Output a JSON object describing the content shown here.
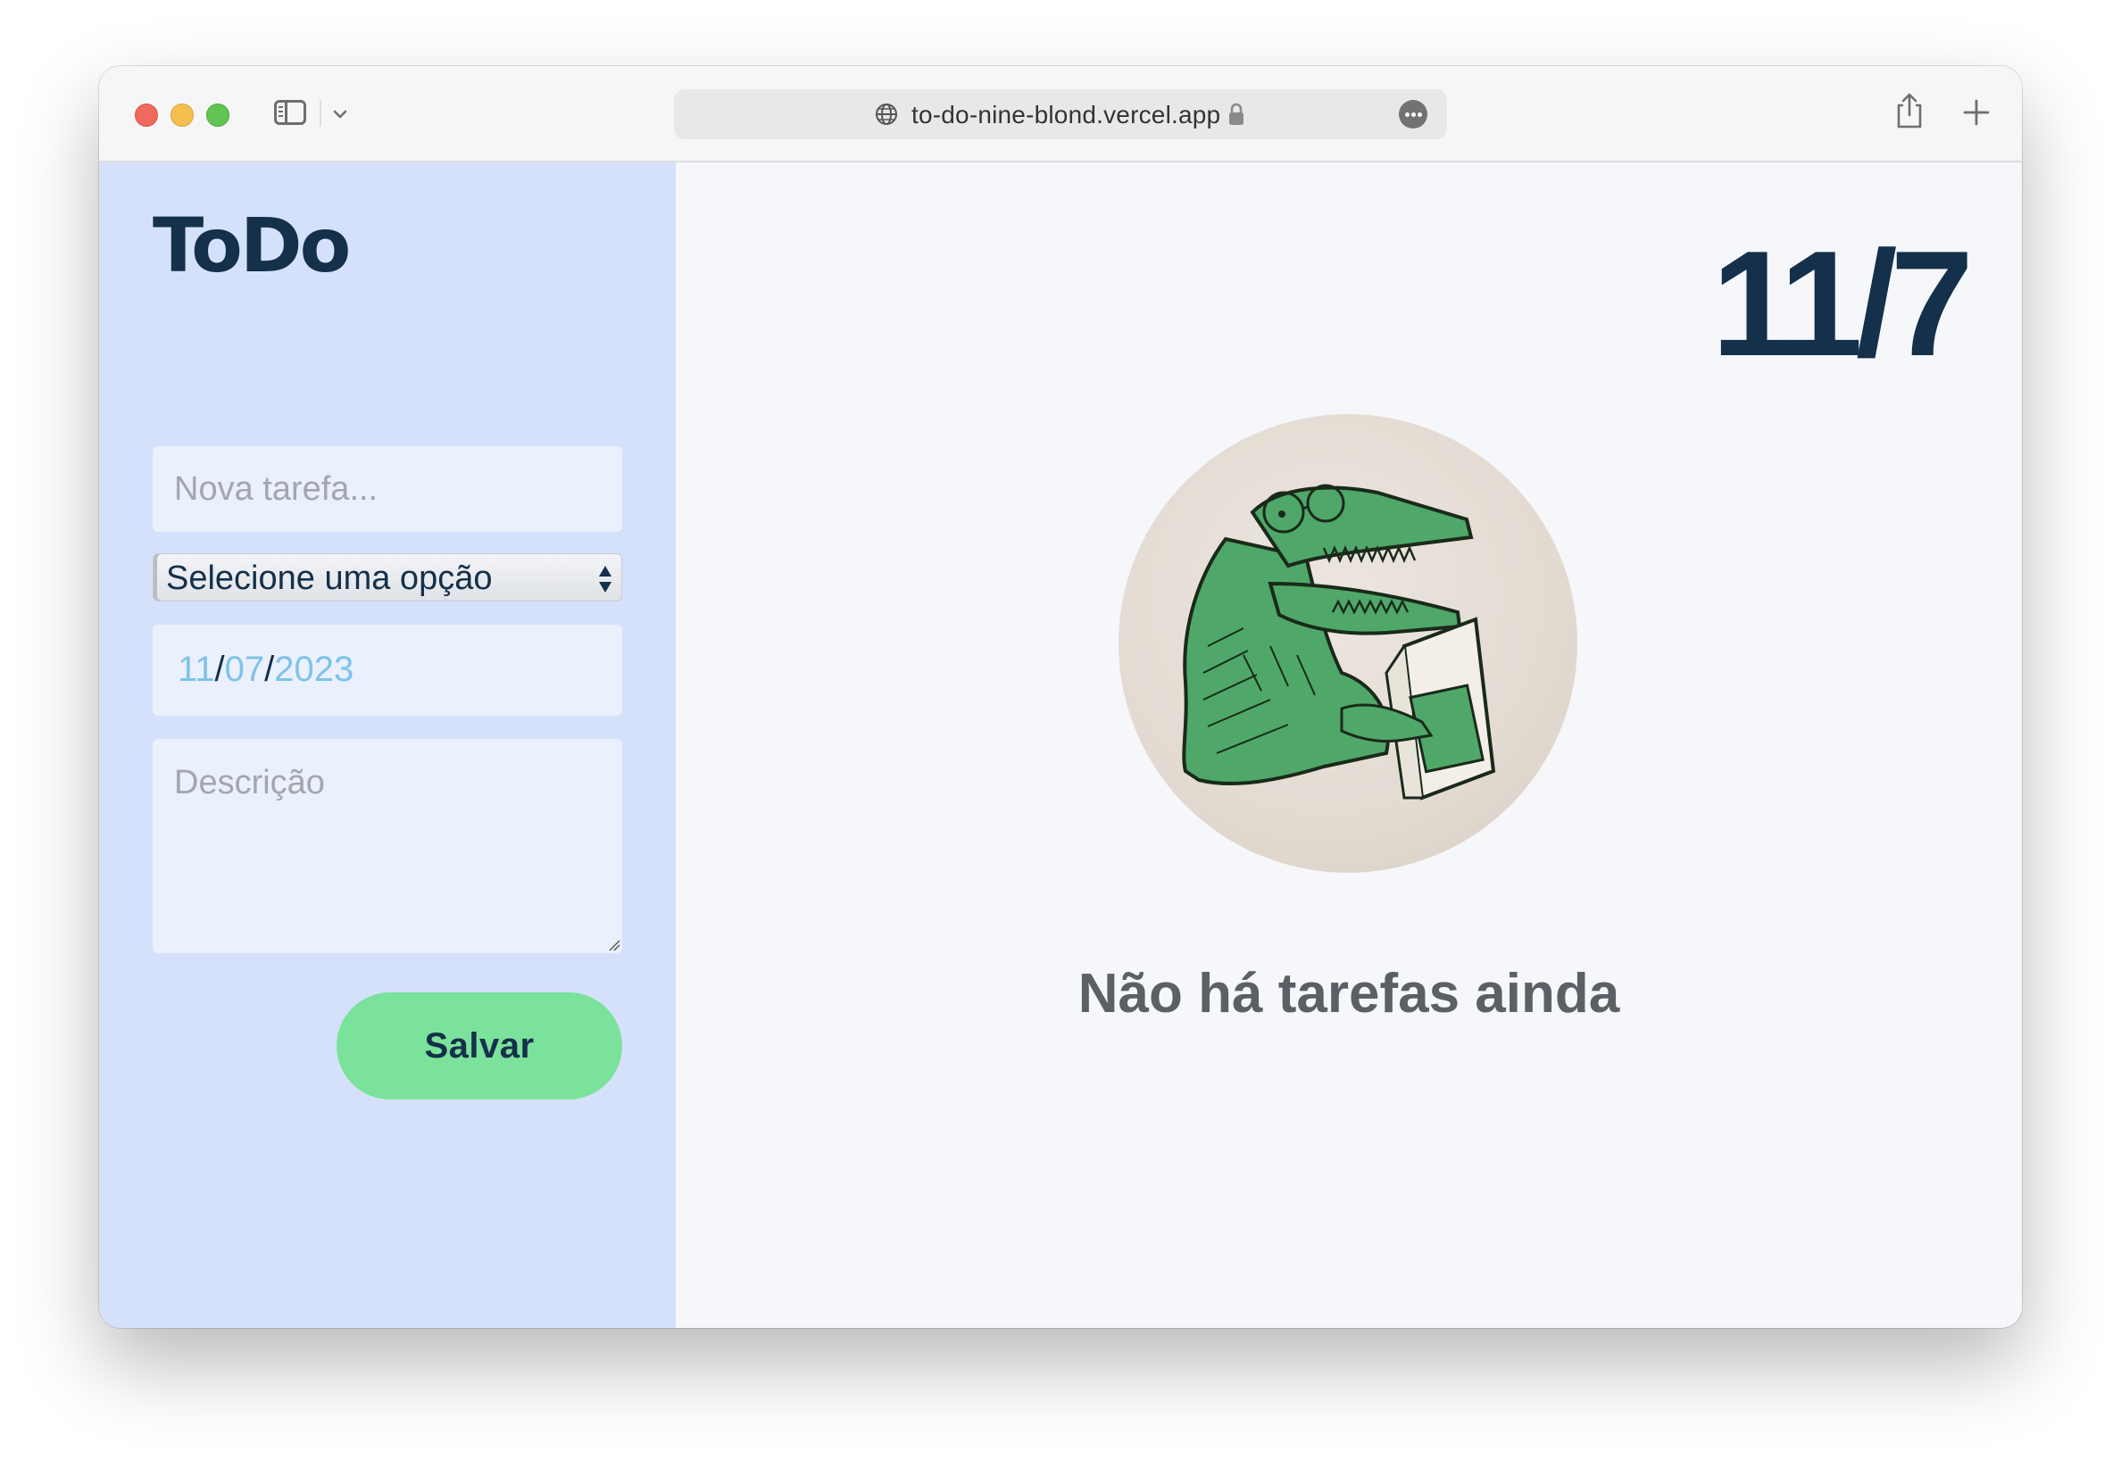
{
  "browser": {
    "url": "to-do-nine-blond.vercel.app"
  },
  "sidebar": {
    "logo": "ToDo",
    "task_input": {
      "placeholder": "Nova tarefa..."
    },
    "category_select": {
      "selected": "Selecione uma opção"
    },
    "date_input": {
      "day": "11",
      "month": "07",
      "year": "2023",
      "separator": "/"
    },
    "description": {
      "placeholder": "Descrição"
    },
    "save_label": "Salvar"
  },
  "main": {
    "date_display": "11/7",
    "empty_message": "Não há tarefas ainda",
    "illustration": "crocodile-reading-book-illustration"
  },
  "colors": {
    "sidebar_bg": "#d5e1fb",
    "main_bg": "#f6f7fb",
    "accent_green": "#7be29b",
    "text_navy": "#14304a",
    "date_blue": "#7ec3ea"
  }
}
